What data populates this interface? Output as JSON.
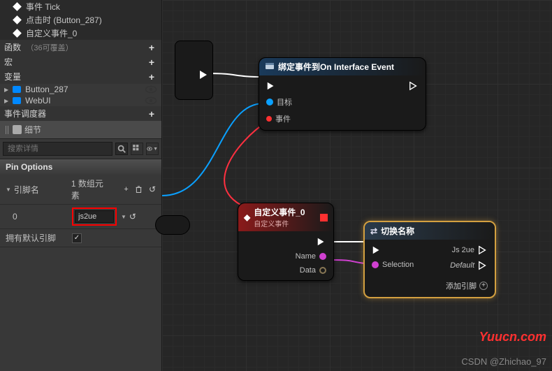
{
  "tree": {
    "tick_suffix": "Tick",
    "click_event": "点击时 (Button_287)",
    "custom_event": "自定义事件_0"
  },
  "sections": {
    "functions": {
      "label": "函数",
      "hint": "（36可覆盖）"
    },
    "macros": {
      "label": "宏"
    },
    "variables": {
      "label": "变量"
    },
    "dispatchers": {
      "label": "事件调度器"
    }
  },
  "vars": {
    "button": "Button_287",
    "webui": "WebUI"
  },
  "details_tab": "细节",
  "search_placeholder": "搜索详情",
  "pin_options": {
    "header": "Pin Options",
    "pin_name": "引脚名",
    "array_count": "1 数组元素",
    "index": "0",
    "value": "js2ue",
    "has_default": "拥有默认引脚"
  },
  "nodes": {
    "mini_out": "",
    "bind": {
      "title": "绑定事件到On Interface Event",
      "target": "目标",
      "event": "事件"
    },
    "custom": {
      "title": "自定义事件_0",
      "subtitle": "自定义事件",
      "name": "Name",
      "data": "Data"
    },
    "switch": {
      "title": "切换名称",
      "selection": "Selection",
      "js2ue": "Js 2ue",
      "default": "Default",
      "add_pin": "添加引脚"
    }
  },
  "watermarks": {
    "w1": "Yuucn.com",
    "w2": "CSDN @Zhichao_97"
  }
}
